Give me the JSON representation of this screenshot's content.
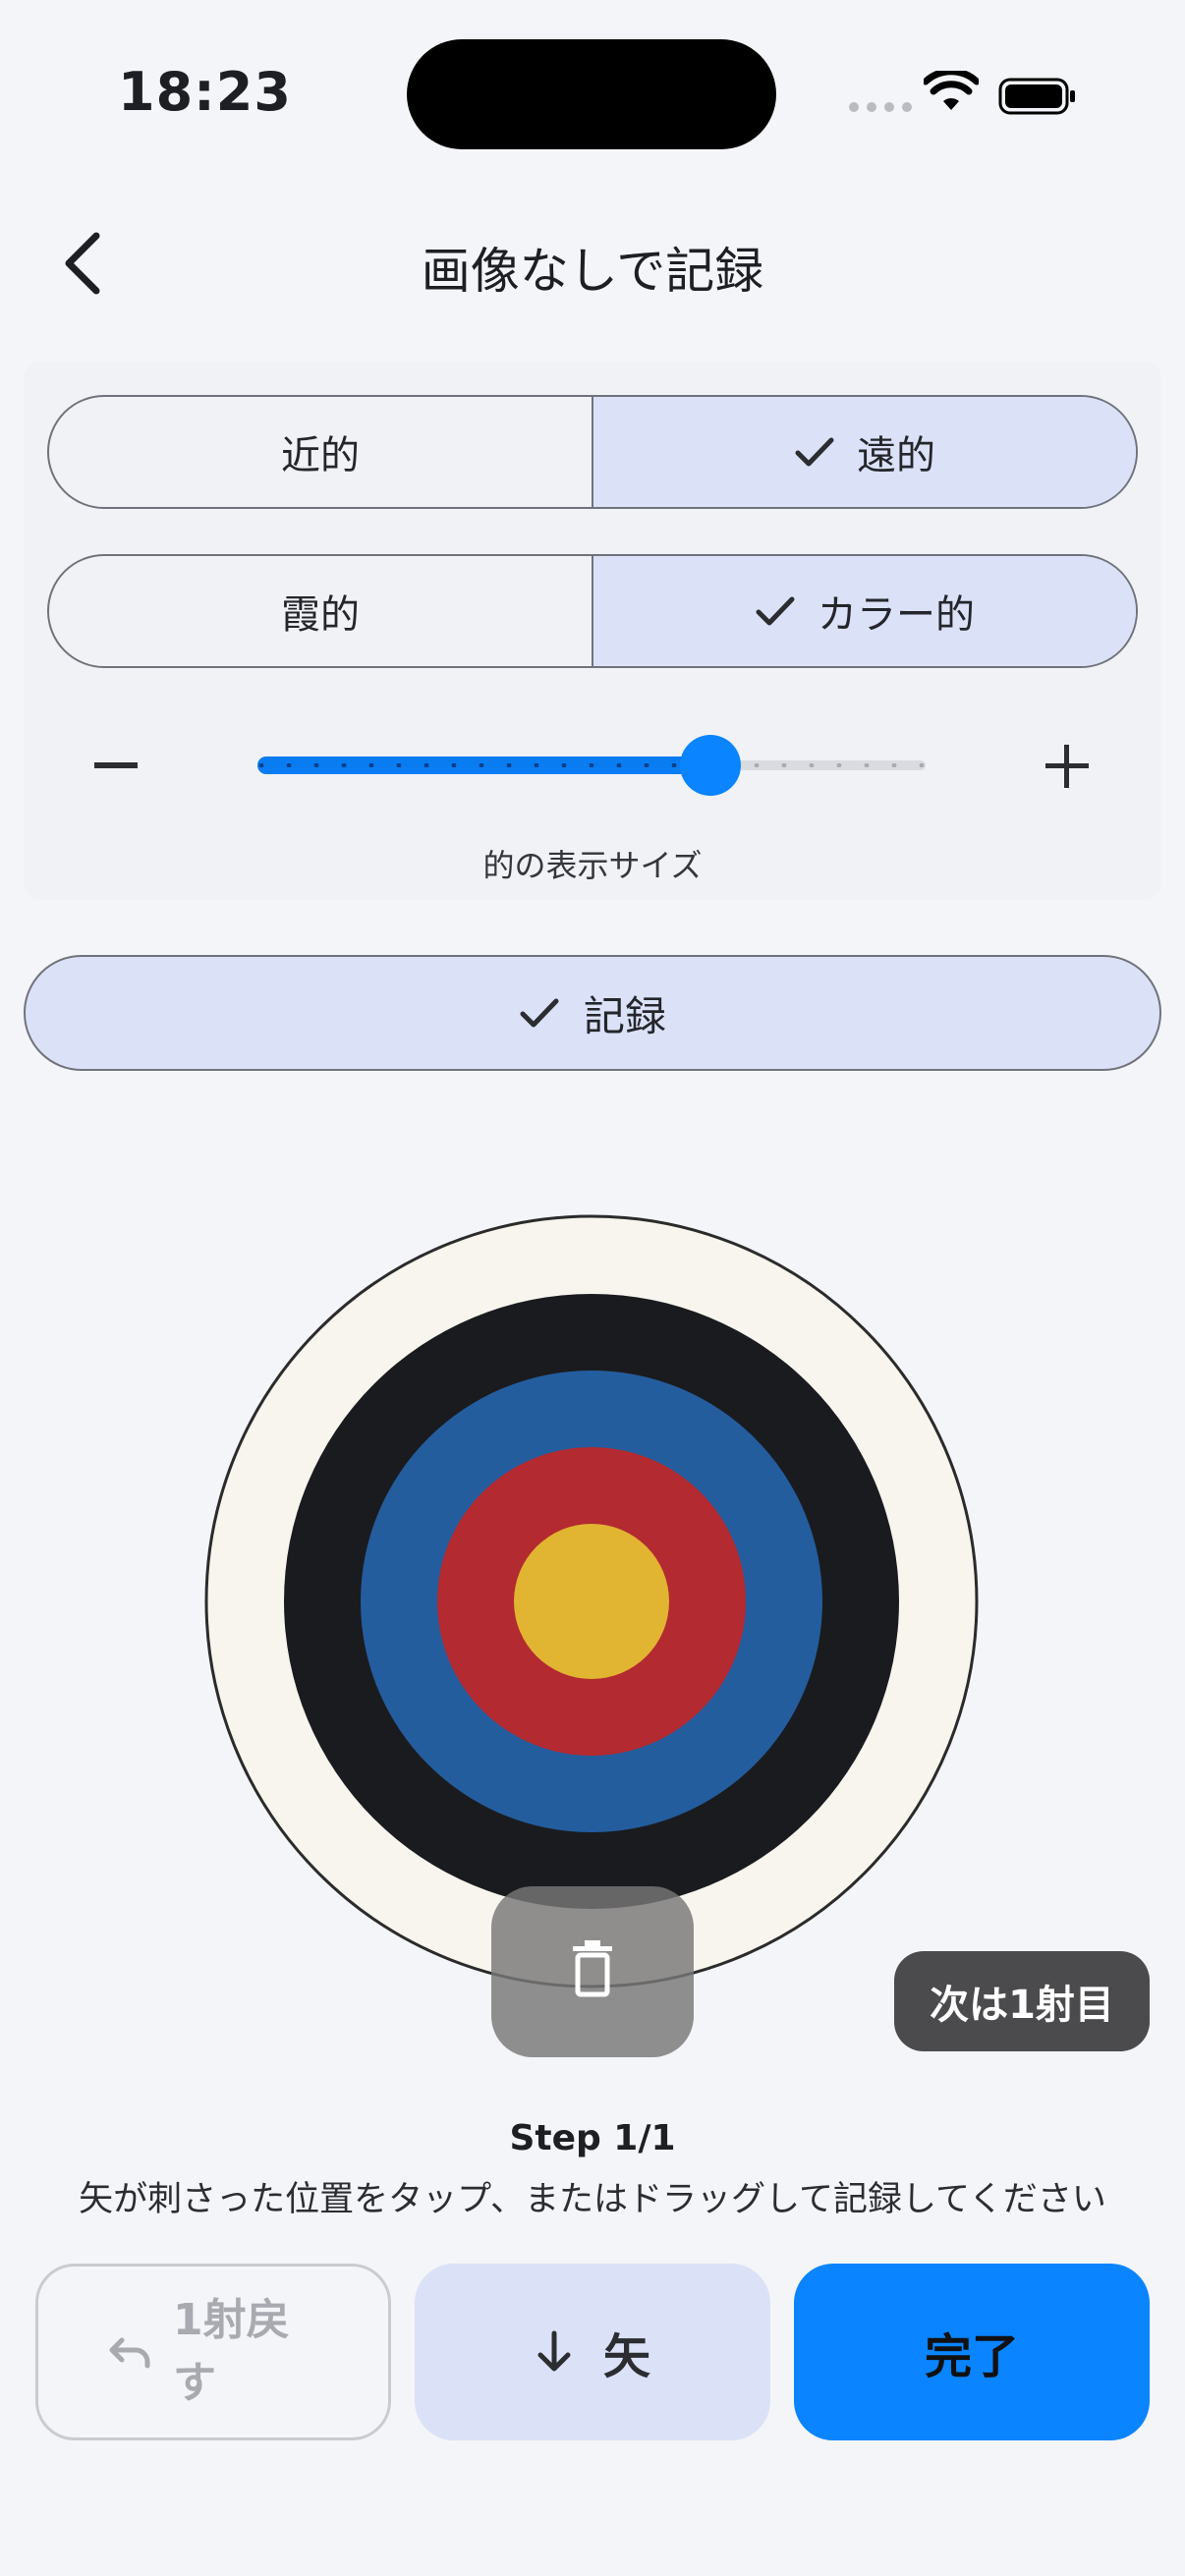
{
  "status_bar": {
    "time": "18:23"
  },
  "nav": {
    "title": "画像なしで記録"
  },
  "distance": {
    "options": [
      "近的",
      "遠的"
    ],
    "selected": "遠的"
  },
  "target_type": {
    "options": [
      "霞的",
      "カラー的"
    ],
    "selected": "カラー的"
  },
  "size_slider": {
    "label": "的の表示サイズ",
    "value_fraction": 0.68
  },
  "record_toggle": {
    "label": "記録",
    "checked": true
  },
  "target": {
    "ring_colors": [
      "#f8f5ee",
      "#1a1b1f",
      "#245d9e",
      "#b32a31",
      "#e1b431"
    ]
  },
  "next_badge": "次は1射目",
  "step": {
    "title": "Step 1/1",
    "instruction": "矢が刺さった位置をタップ、またはドラッグして記録してください"
  },
  "actions": {
    "undo_label": "1射戻す",
    "arrow_label": "矢",
    "done_label": "完了"
  },
  "colors": {
    "accent": "#0a84ff",
    "selected_bg": "#dbe2f8",
    "background": "#f4f5f8"
  }
}
